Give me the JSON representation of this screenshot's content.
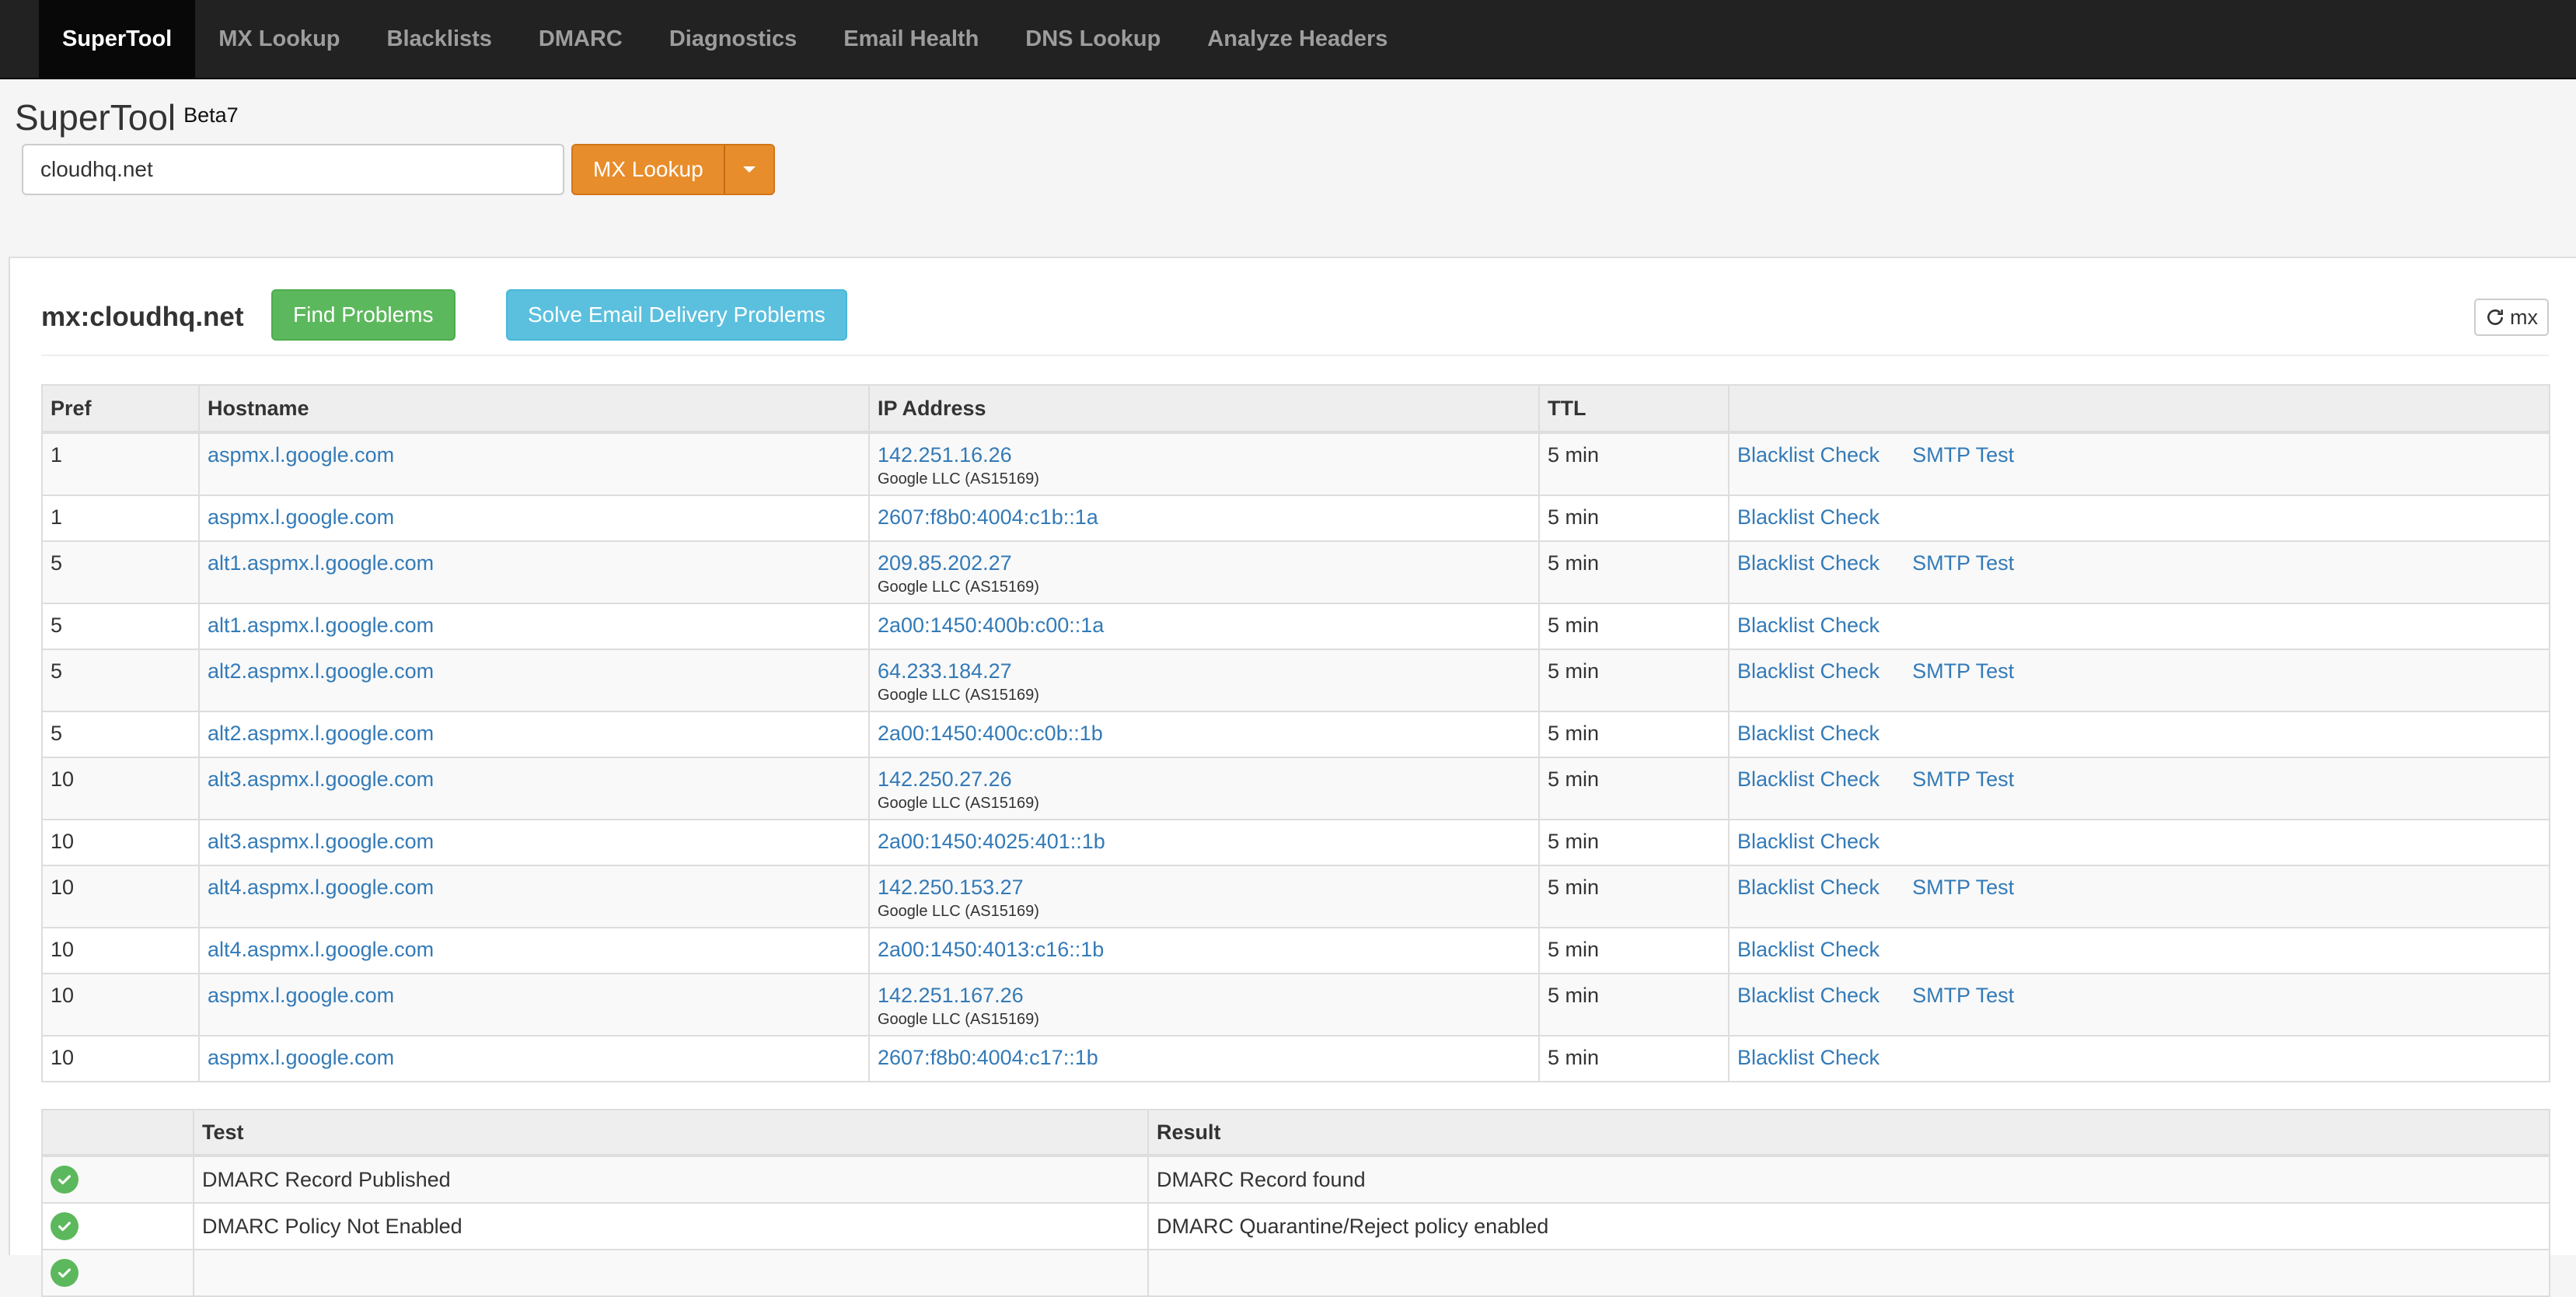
{
  "nav": {
    "items": [
      "SuperTool",
      "MX Lookup",
      "Blacklists",
      "DMARC",
      "Diagnostics",
      "Email Health",
      "DNS Lookup",
      "Analyze Headers"
    ],
    "active": "SuperTool"
  },
  "header": {
    "title": "SuperTool",
    "badge": "Beta7",
    "search_value": "cloudhq.net",
    "lookup_button": "MX Lookup"
  },
  "panel": {
    "title": "mx:cloudhq.net",
    "find_problems": "Find Problems",
    "solve_problems": "Solve Email Delivery Problems",
    "refresh_label": "mx"
  },
  "mx_table": {
    "headers": [
      "Pref",
      "Hostname",
      "IP Address",
      "TTL",
      ""
    ],
    "rows": [
      {
        "pref": "1",
        "host": "aspmx.l.google.com",
        "ip": "142.251.16.26",
        "asn": "Google LLC (AS15169)",
        "ttl": "5 min",
        "blacklist": "Blacklist Check",
        "smtp": "SMTP Test"
      },
      {
        "pref": "1",
        "host": "aspmx.l.google.com",
        "ip": "2607:f8b0:4004:c1b::1a",
        "asn": "",
        "ttl": "5 min",
        "blacklist": "Blacklist Check",
        "smtp": ""
      },
      {
        "pref": "5",
        "host": "alt1.aspmx.l.google.com",
        "ip": "209.85.202.27",
        "asn": "Google LLC (AS15169)",
        "ttl": "5 min",
        "blacklist": "Blacklist Check",
        "smtp": "SMTP Test"
      },
      {
        "pref": "5",
        "host": "alt1.aspmx.l.google.com",
        "ip": "2a00:1450:400b:c00::1a",
        "asn": "",
        "ttl": "5 min",
        "blacklist": "Blacklist Check",
        "smtp": ""
      },
      {
        "pref": "5",
        "host": "alt2.aspmx.l.google.com",
        "ip": "64.233.184.27",
        "asn": "Google LLC (AS15169)",
        "ttl": "5 min",
        "blacklist": "Blacklist Check",
        "smtp": "SMTP Test"
      },
      {
        "pref": "5",
        "host": "alt2.aspmx.l.google.com",
        "ip": "2a00:1450:400c:c0b::1b",
        "asn": "",
        "ttl": "5 min",
        "blacklist": "Blacklist Check",
        "smtp": ""
      },
      {
        "pref": "10",
        "host": "alt3.aspmx.l.google.com",
        "ip": "142.250.27.26",
        "asn": "Google LLC (AS15169)",
        "ttl": "5 min",
        "blacklist": "Blacklist Check",
        "smtp": "SMTP Test"
      },
      {
        "pref": "10",
        "host": "alt3.aspmx.l.google.com",
        "ip": "2a00:1450:4025:401::1b",
        "asn": "",
        "ttl": "5 min",
        "blacklist": "Blacklist Check",
        "smtp": ""
      },
      {
        "pref": "10",
        "host": "alt4.aspmx.l.google.com",
        "ip": "142.250.153.27",
        "asn": "Google LLC (AS15169)",
        "ttl": "5 min",
        "blacklist": "Blacklist Check",
        "smtp": "SMTP Test"
      },
      {
        "pref": "10",
        "host": "alt4.aspmx.l.google.com",
        "ip": "2a00:1450:4013:c16::1b",
        "asn": "",
        "ttl": "5 min",
        "blacklist": "Blacklist Check",
        "smtp": ""
      },
      {
        "pref": "10",
        "host": "aspmx.l.google.com",
        "ip": "142.251.167.26",
        "asn": "Google LLC (AS15169)",
        "ttl": "5 min",
        "blacklist": "Blacklist Check",
        "smtp": "SMTP Test"
      },
      {
        "pref": "10",
        "host": "aspmx.l.google.com",
        "ip": "2607:f8b0:4004:c17::1b",
        "asn": "",
        "ttl": "5 min",
        "blacklist": "Blacklist Check",
        "smtp": ""
      }
    ]
  },
  "test_table": {
    "headers": [
      "",
      "Test",
      "Result"
    ],
    "rows": [
      {
        "status": "ok",
        "test": "DMARC Record Published",
        "result": "DMARC Record found"
      },
      {
        "status": "ok",
        "test": "DMARC Policy Not Enabled",
        "result": "DMARC Quarantine/Reject policy enabled"
      },
      {
        "status": "ok",
        "test": "",
        "result": ""
      }
    ]
  },
  "colors": {
    "navbar": "#222222",
    "link": "#337ab7",
    "mx_button": "#e88d2b",
    "find_button": "#5cb85c",
    "solve_button": "#5bc0de"
  },
  "icons": {
    "refresh": "refresh-icon",
    "check": "check-circle-icon",
    "caret": "caret-down-icon"
  }
}
